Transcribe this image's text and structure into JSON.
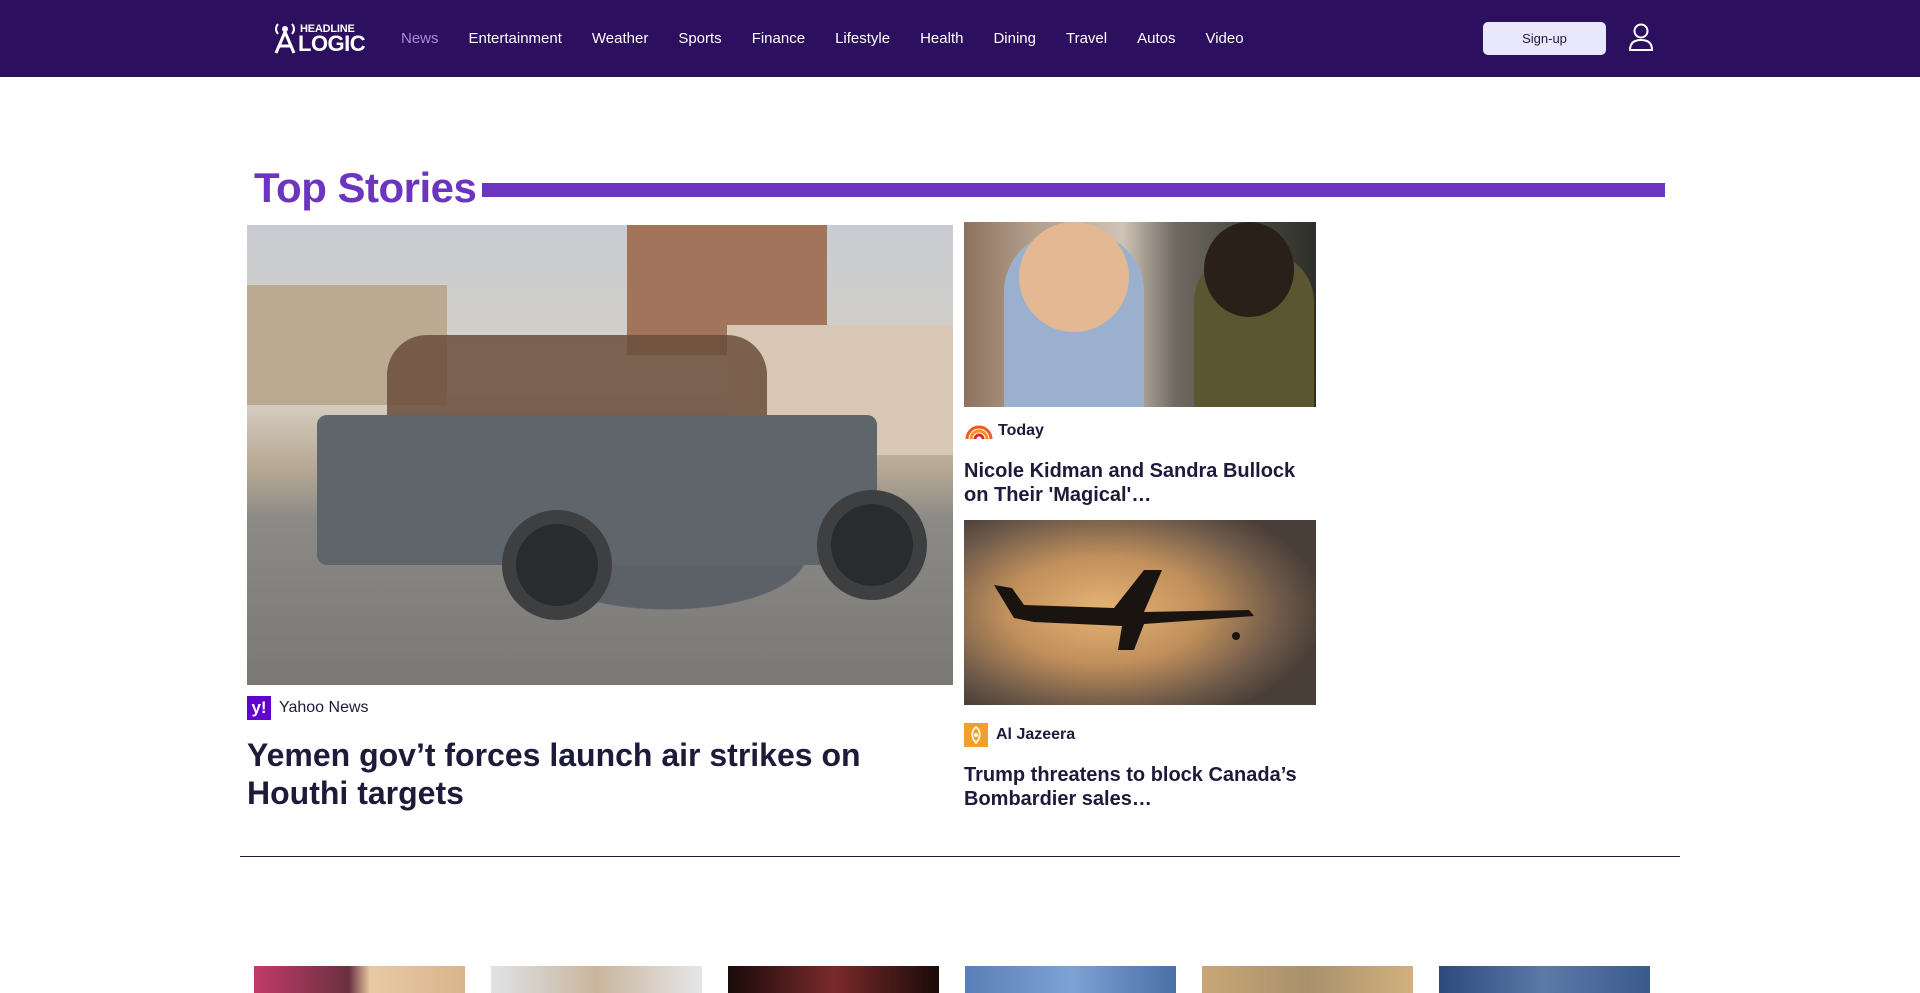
{
  "header": {
    "logo_top": "HEADLINE",
    "logo_bottom": "LOGIC",
    "nav": [
      {
        "label": "News",
        "active": true
      },
      {
        "label": "Entertainment"
      },
      {
        "label": "Weather"
      },
      {
        "label": "Sports"
      },
      {
        "label": "Finance"
      },
      {
        "label": "Lifestyle"
      },
      {
        "label": "Health"
      },
      {
        "label": "Dining"
      },
      {
        "label": "Travel"
      },
      {
        "label": "Autos"
      },
      {
        "label": "Video"
      }
    ],
    "signup_label": "Sign-up",
    "user_icon": "user-icon"
  },
  "top_stories": {
    "title": "Top Stories",
    "main": {
      "source": "Yahoo News",
      "source_icon": "yahoo-icon",
      "headline": "Yemen gov’t forces launch air strikes on Houthi targets"
    },
    "side": [
      {
        "source": "Today",
        "source_icon": "today-icon",
        "headline": "Nicole Kidman and Sandra Bullock on Their 'Magical'…"
      },
      {
        "source": "Al Jazeera",
        "source_icon": "al-jazeera-icon",
        "headline": "Trump threatens to block Canada’s Bombardier sales…"
      }
    ]
  },
  "colors": {
    "header_bg": "#2c0f5e",
    "accent": "#6b35bf",
    "active_nav": "#a58bd9",
    "text": "#1d1a3a",
    "signup_bg": "#e8e7fb"
  }
}
